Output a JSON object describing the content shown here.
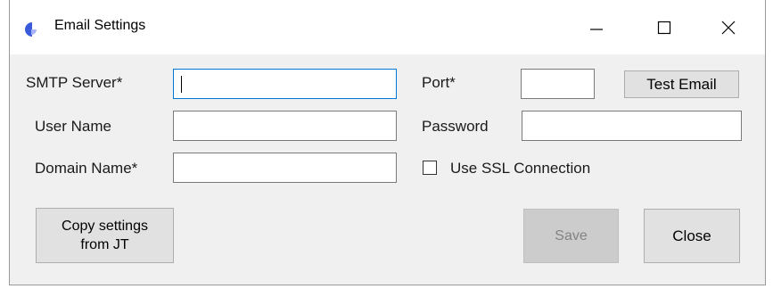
{
  "window": {
    "title": "Email Settings",
    "icon": "app-logo-icon",
    "controls": {
      "minimize": "minimize-icon",
      "maximize": "maximize-icon",
      "close": "close-icon"
    }
  },
  "form": {
    "smtp_server": {
      "label": "SMTP Server*",
      "value": ""
    },
    "port": {
      "label": "Port*",
      "value": ""
    },
    "test_email_label": "Test Email",
    "user_name": {
      "label": "User Name",
      "value": ""
    },
    "password": {
      "label": "Password",
      "value": ""
    },
    "domain_name": {
      "label": "Domain Name*",
      "value": ""
    },
    "use_ssl": {
      "label": "Use SSL Connection",
      "checked": false
    }
  },
  "buttons": {
    "copy_settings_line1": "Copy settings",
    "copy_settings_line2": "from JT",
    "save": "Save",
    "close": "Close"
  },
  "colors": {
    "focus_border": "#0078d7",
    "logo_blue": "#3b5bdb",
    "logo_light": "#a5b4fc"
  }
}
